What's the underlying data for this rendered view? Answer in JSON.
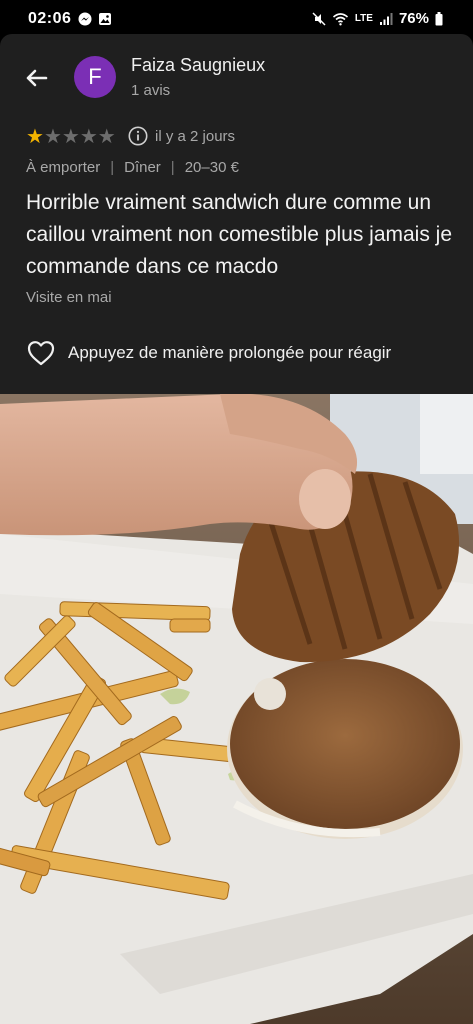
{
  "status_bar": {
    "time": "02:06",
    "battery": "76%",
    "network": "LTE"
  },
  "review": {
    "author_name": "Faiza Saugnieux",
    "avatar_letter": "F",
    "avatar_color": "#7b2fb5",
    "author_reviews": "1 avis",
    "rating": 1,
    "max_rating": 5,
    "time_ago": "il y a 2 jours",
    "meta": {
      "service": "À emporter",
      "meal": "Dîner",
      "price": "20–30 €",
      "separator": "|"
    },
    "text": "Horrible vraiment sandwich dure comme un caillou vraiment non comestible plus jamais je commande dans ce macdo",
    "visit": "Visite en mai",
    "react_label": "Appuyez de manière prolongée pour réagir"
  },
  "colors": {
    "background": "#1f1f1f",
    "star_on": "#f4b400",
    "star_off": "#6d6d6d"
  }
}
